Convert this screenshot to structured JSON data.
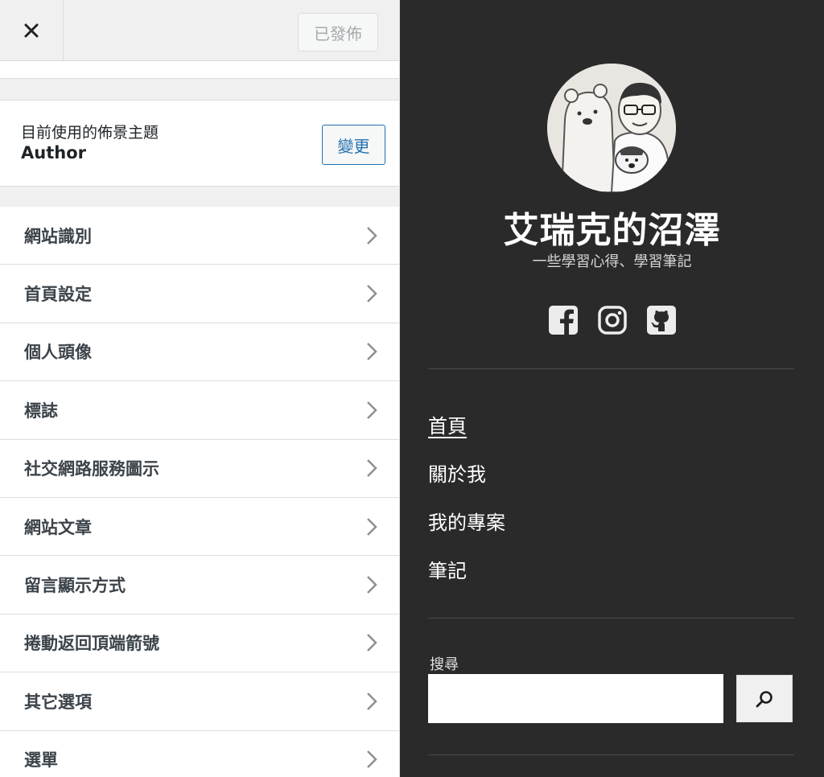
{
  "customizer": {
    "publish_label": "已發佈",
    "theme": {
      "caption": "目前使用的佈景主題",
      "name": "Author",
      "change_label": "變更"
    },
    "sections": [
      {
        "label": "網站識別"
      },
      {
        "label": "首頁設定"
      },
      {
        "label": "個人頭像"
      },
      {
        "label": "標誌"
      },
      {
        "label": "社交網路服務圖示"
      },
      {
        "label": "網站文章"
      },
      {
        "label": "留言顯示方式"
      },
      {
        "label": "捲動返回頂端箭號"
      },
      {
        "label": "其它選項"
      },
      {
        "label": "選單"
      }
    ]
  },
  "preview": {
    "site_title": "艾瑞克的沼澤",
    "tagline": "一些學習心得、學習筆記",
    "social_icons": [
      "facebook-icon",
      "instagram-icon",
      "github-icon"
    ],
    "nav": [
      {
        "label": "首頁",
        "current": true
      },
      {
        "label": "關於我"
      },
      {
        "label": "我的專案"
      },
      {
        "label": "筆記"
      }
    ],
    "search": {
      "label": "搜尋",
      "value": "",
      "placeholder": ""
    }
  },
  "colors": {
    "panel_bg": "#f0f0f1",
    "accent": "#2271b1",
    "preview_bg": "#2a2a2b"
  }
}
